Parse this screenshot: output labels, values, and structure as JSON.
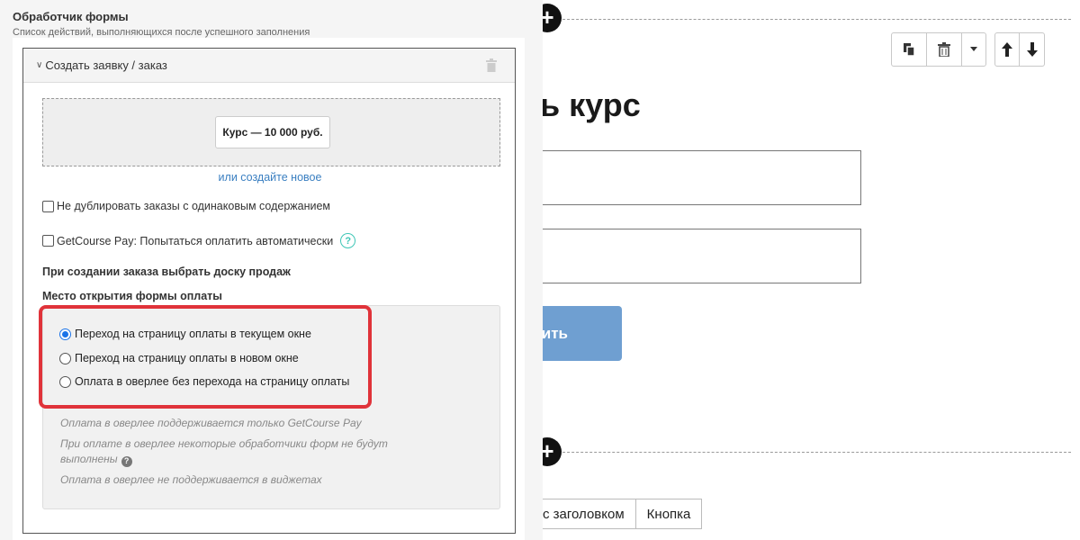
{
  "panel": {
    "title": "Обработчик формы",
    "subtitle": "Список действий, выполняющихся после успешного заполнения"
  },
  "action": {
    "title": "Создать заявку / заказ",
    "product_label": "Курс — 10 000 руб.",
    "create_link": "или создайте новое",
    "no_duplicate_label": "Не дублировать заказы с одинаковым содержанием",
    "gc_pay_label": "GetCourse Pay: Попытаться оплатить автоматически",
    "sales_board_label": "При создании заказа выбрать доску продаж",
    "payment_place_label": "Место открытия формы оплаты",
    "radio_options": [
      {
        "label": "Переход на страницу оплаты в текущем окне",
        "checked": true
      },
      {
        "label": "Переход на страницу оплаты в новом окне",
        "checked": false
      },
      {
        "label": "Оплата в оверлее без перехода на страницу оплаты",
        "checked": false
      }
    ],
    "notes": [
      "Оплата в оверлее поддерживается только GetCourse Pay",
      "При оплате в оверлее некоторые обработчики форм не будут выполнены",
      "Оплата в оверлее не поддерживается в виджетах"
    ],
    "highlight_color": "#e0333a"
  },
  "editor": {
    "heading": "ь курс",
    "submit_label": "ить",
    "submit_color": "#6f9fd1",
    "tabs": [
      "с заголовком",
      "Кнопка"
    ]
  },
  "icons": {
    "toolbar": [
      "copy-icon",
      "trash-icon",
      "caret-down-icon",
      "arrow-up-icon",
      "arrow-down-icon"
    ],
    "add": "plus-icon",
    "help": "question-icon"
  }
}
